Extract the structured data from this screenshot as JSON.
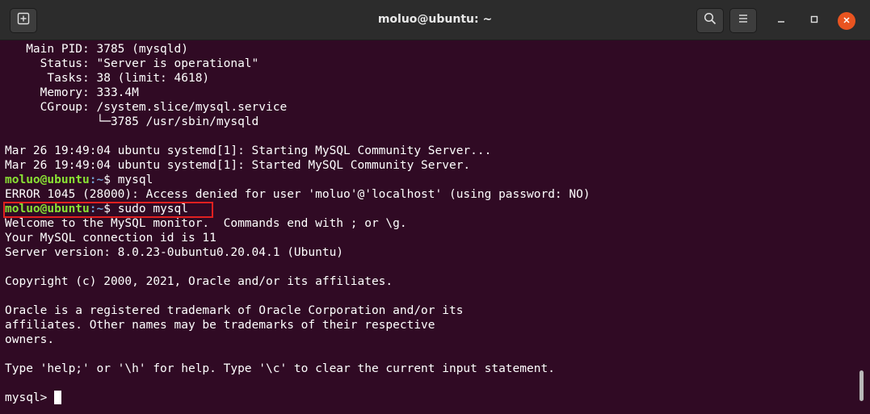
{
  "window": {
    "title": "moluo@ubuntu: ~"
  },
  "titlebar": {
    "new_tab_icon": "new-tab-icon",
    "search_icon": "search-icon",
    "menu_icon": "hamburger-menu-icon",
    "minimize_icon": "minimize-icon",
    "maximize_icon": "maximize-icon",
    "close_icon": "close-icon"
  },
  "colors": {
    "terminal_bg": "#300a24",
    "titlebar_bg": "#2c2c2c",
    "prompt_user": "#8ae234",
    "prompt_path": "#729fcf",
    "close_button": "#e95420",
    "highlight_border": "#e02020"
  },
  "terminal": {
    "lines": [
      "   Main PID: 3785 (mysqld)",
      "     Status: \"Server is operational\"",
      "      Tasks: 38 (limit: 4618)",
      "     Memory: 333.4M",
      "     CGroup: /system.slice/mysql.service",
      "             └─3785 /usr/sbin/mysqld",
      "",
      "Mar 26 19:49:04 ubuntu systemd[1]: Starting MySQL Community Server...",
      "Mar 26 19:49:04 ubuntu systemd[1]: Started MySQL Community Server."
    ],
    "prompt1": {
      "user": "moluo@ubuntu",
      "path": ":~",
      "symbol": "$ ",
      "command": "mysql"
    },
    "error_line": "ERROR 1045 (28000): Access denied for user 'moluo'@'localhost' (using password: NO)",
    "prompt2": {
      "user": "moluo@ubuntu",
      "path": ":~",
      "symbol": "$ ",
      "command": "sudo mysql"
    },
    "output_lines": [
      "Welcome to the MySQL monitor.  Commands end with ; or \\g.",
      "Your MySQL connection id is 11",
      "Server version: 8.0.23-0ubuntu0.20.04.1 (Ubuntu)",
      "",
      "Copyright (c) 2000, 2021, Oracle and/or its affiliates.",
      "",
      "Oracle is a registered trademark of Oracle Corporation and/or its",
      "affiliates. Other names may be trademarks of their respective",
      "owners.",
      "",
      "Type 'help;' or '\\h' for help. Type '\\c' to clear the current input statement.",
      ""
    ],
    "mysql_prompt": "mysql> "
  }
}
